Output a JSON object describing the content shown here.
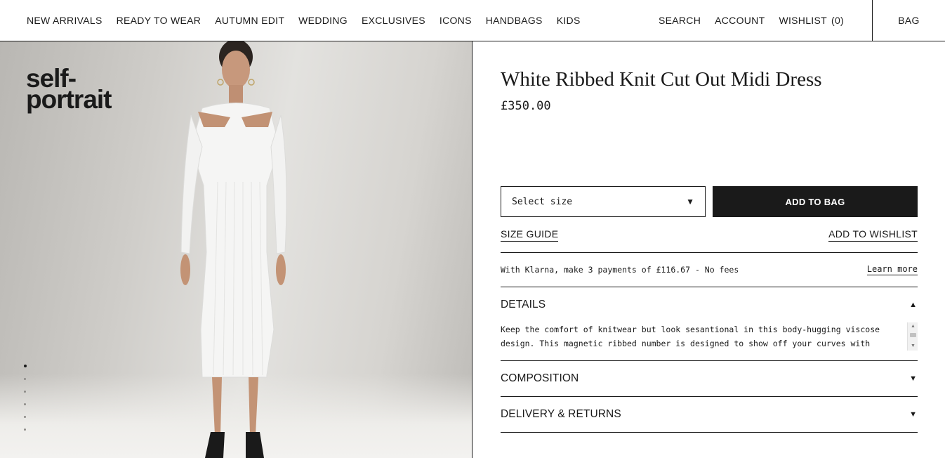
{
  "nav": {
    "left": [
      "NEW ARRIVALS",
      "READY TO WEAR",
      "AUTUMN EDIT",
      "WEDDING",
      "EXCLUSIVES",
      "ICONS",
      "HANDBAGS",
      "KIDS"
    ],
    "search": "SEARCH",
    "account": "ACCOUNT",
    "wishlist": "WISHLIST",
    "wishlist_count": "(0)",
    "bag": "BAG"
  },
  "brand": {
    "logo_line1": "self-",
    "logo_line2": "portrait"
  },
  "gallery": {
    "slide_count": 6,
    "active_slide": 1
  },
  "product": {
    "title": "White Ribbed Knit Cut Out Midi Dress",
    "price": "£350.00",
    "size_placeholder": "Select size",
    "add_to_bag": "ADD TO BAG",
    "size_guide": "SIZE GUIDE",
    "add_to_wishlist": "ADD TO WISHLIST"
  },
  "klarna": {
    "text": "With Klarna, make 3 payments of £116.67 - No fees",
    "learn_more": "Learn more"
  },
  "accordion": {
    "details": {
      "label": "DETAILS",
      "expanded": true,
      "body": "Keep the comfort of knitwear but look sesantional in this body-hugging viscose design. This magnetic ribbed number is designed to show off your curves with"
    },
    "composition": {
      "label": "COMPOSITION",
      "expanded": false
    },
    "delivery": {
      "label": "DELIVERY & RETURNS",
      "expanded": false
    }
  },
  "icons": {
    "expanded": "▲",
    "collapsed": "▼",
    "select_caret": "▼"
  },
  "colors": {
    "text": "#1a1a1a",
    "button_bg": "#1a1a1a",
    "button_text": "#ffffff",
    "background": "#ffffff"
  }
}
